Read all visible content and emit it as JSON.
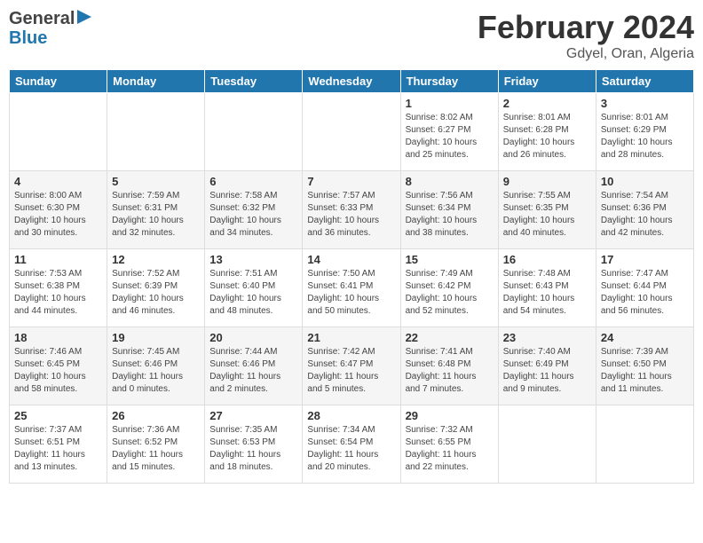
{
  "header": {
    "logo_general": "General",
    "logo_blue": "Blue",
    "title": "February 2024",
    "location": "Gdyel, Oran, Algeria"
  },
  "weekdays": [
    "Sunday",
    "Monday",
    "Tuesday",
    "Wednesday",
    "Thursday",
    "Friday",
    "Saturday"
  ],
  "weeks": [
    [
      {
        "day": "",
        "info": ""
      },
      {
        "day": "",
        "info": ""
      },
      {
        "day": "",
        "info": ""
      },
      {
        "day": "",
        "info": ""
      },
      {
        "day": "1",
        "info": "Sunrise: 8:02 AM\nSunset: 6:27 PM\nDaylight: 10 hours\nand 25 minutes."
      },
      {
        "day": "2",
        "info": "Sunrise: 8:01 AM\nSunset: 6:28 PM\nDaylight: 10 hours\nand 26 minutes."
      },
      {
        "day": "3",
        "info": "Sunrise: 8:01 AM\nSunset: 6:29 PM\nDaylight: 10 hours\nand 28 minutes."
      }
    ],
    [
      {
        "day": "4",
        "info": "Sunrise: 8:00 AM\nSunset: 6:30 PM\nDaylight: 10 hours\nand 30 minutes."
      },
      {
        "day": "5",
        "info": "Sunrise: 7:59 AM\nSunset: 6:31 PM\nDaylight: 10 hours\nand 32 minutes."
      },
      {
        "day": "6",
        "info": "Sunrise: 7:58 AM\nSunset: 6:32 PM\nDaylight: 10 hours\nand 34 minutes."
      },
      {
        "day": "7",
        "info": "Sunrise: 7:57 AM\nSunset: 6:33 PM\nDaylight: 10 hours\nand 36 minutes."
      },
      {
        "day": "8",
        "info": "Sunrise: 7:56 AM\nSunset: 6:34 PM\nDaylight: 10 hours\nand 38 minutes."
      },
      {
        "day": "9",
        "info": "Sunrise: 7:55 AM\nSunset: 6:35 PM\nDaylight: 10 hours\nand 40 minutes."
      },
      {
        "day": "10",
        "info": "Sunrise: 7:54 AM\nSunset: 6:36 PM\nDaylight: 10 hours\nand 42 minutes."
      }
    ],
    [
      {
        "day": "11",
        "info": "Sunrise: 7:53 AM\nSunset: 6:38 PM\nDaylight: 10 hours\nand 44 minutes."
      },
      {
        "day": "12",
        "info": "Sunrise: 7:52 AM\nSunset: 6:39 PM\nDaylight: 10 hours\nand 46 minutes."
      },
      {
        "day": "13",
        "info": "Sunrise: 7:51 AM\nSunset: 6:40 PM\nDaylight: 10 hours\nand 48 minutes."
      },
      {
        "day": "14",
        "info": "Sunrise: 7:50 AM\nSunset: 6:41 PM\nDaylight: 10 hours\nand 50 minutes."
      },
      {
        "day": "15",
        "info": "Sunrise: 7:49 AM\nSunset: 6:42 PM\nDaylight: 10 hours\nand 52 minutes."
      },
      {
        "day": "16",
        "info": "Sunrise: 7:48 AM\nSunset: 6:43 PM\nDaylight: 10 hours\nand 54 minutes."
      },
      {
        "day": "17",
        "info": "Sunrise: 7:47 AM\nSunset: 6:44 PM\nDaylight: 10 hours\nand 56 minutes."
      }
    ],
    [
      {
        "day": "18",
        "info": "Sunrise: 7:46 AM\nSunset: 6:45 PM\nDaylight: 10 hours\nand 58 minutes."
      },
      {
        "day": "19",
        "info": "Sunrise: 7:45 AM\nSunset: 6:46 PM\nDaylight: 11 hours\nand 0 minutes."
      },
      {
        "day": "20",
        "info": "Sunrise: 7:44 AM\nSunset: 6:46 PM\nDaylight: 11 hours\nand 2 minutes."
      },
      {
        "day": "21",
        "info": "Sunrise: 7:42 AM\nSunset: 6:47 PM\nDaylight: 11 hours\nand 5 minutes."
      },
      {
        "day": "22",
        "info": "Sunrise: 7:41 AM\nSunset: 6:48 PM\nDaylight: 11 hours\nand 7 minutes."
      },
      {
        "day": "23",
        "info": "Sunrise: 7:40 AM\nSunset: 6:49 PM\nDaylight: 11 hours\nand 9 minutes."
      },
      {
        "day": "24",
        "info": "Sunrise: 7:39 AM\nSunset: 6:50 PM\nDaylight: 11 hours\nand 11 minutes."
      }
    ],
    [
      {
        "day": "25",
        "info": "Sunrise: 7:37 AM\nSunset: 6:51 PM\nDaylight: 11 hours\nand 13 minutes."
      },
      {
        "day": "26",
        "info": "Sunrise: 7:36 AM\nSunset: 6:52 PM\nDaylight: 11 hours\nand 15 minutes."
      },
      {
        "day": "27",
        "info": "Sunrise: 7:35 AM\nSunset: 6:53 PM\nDaylight: 11 hours\nand 18 minutes."
      },
      {
        "day": "28",
        "info": "Sunrise: 7:34 AM\nSunset: 6:54 PM\nDaylight: 11 hours\nand 20 minutes."
      },
      {
        "day": "29",
        "info": "Sunrise: 7:32 AM\nSunset: 6:55 PM\nDaylight: 11 hours\nand 22 minutes."
      },
      {
        "day": "",
        "info": ""
      },
      {
        "day": "",
        "info": ""
      }
    ]
  ]
}
